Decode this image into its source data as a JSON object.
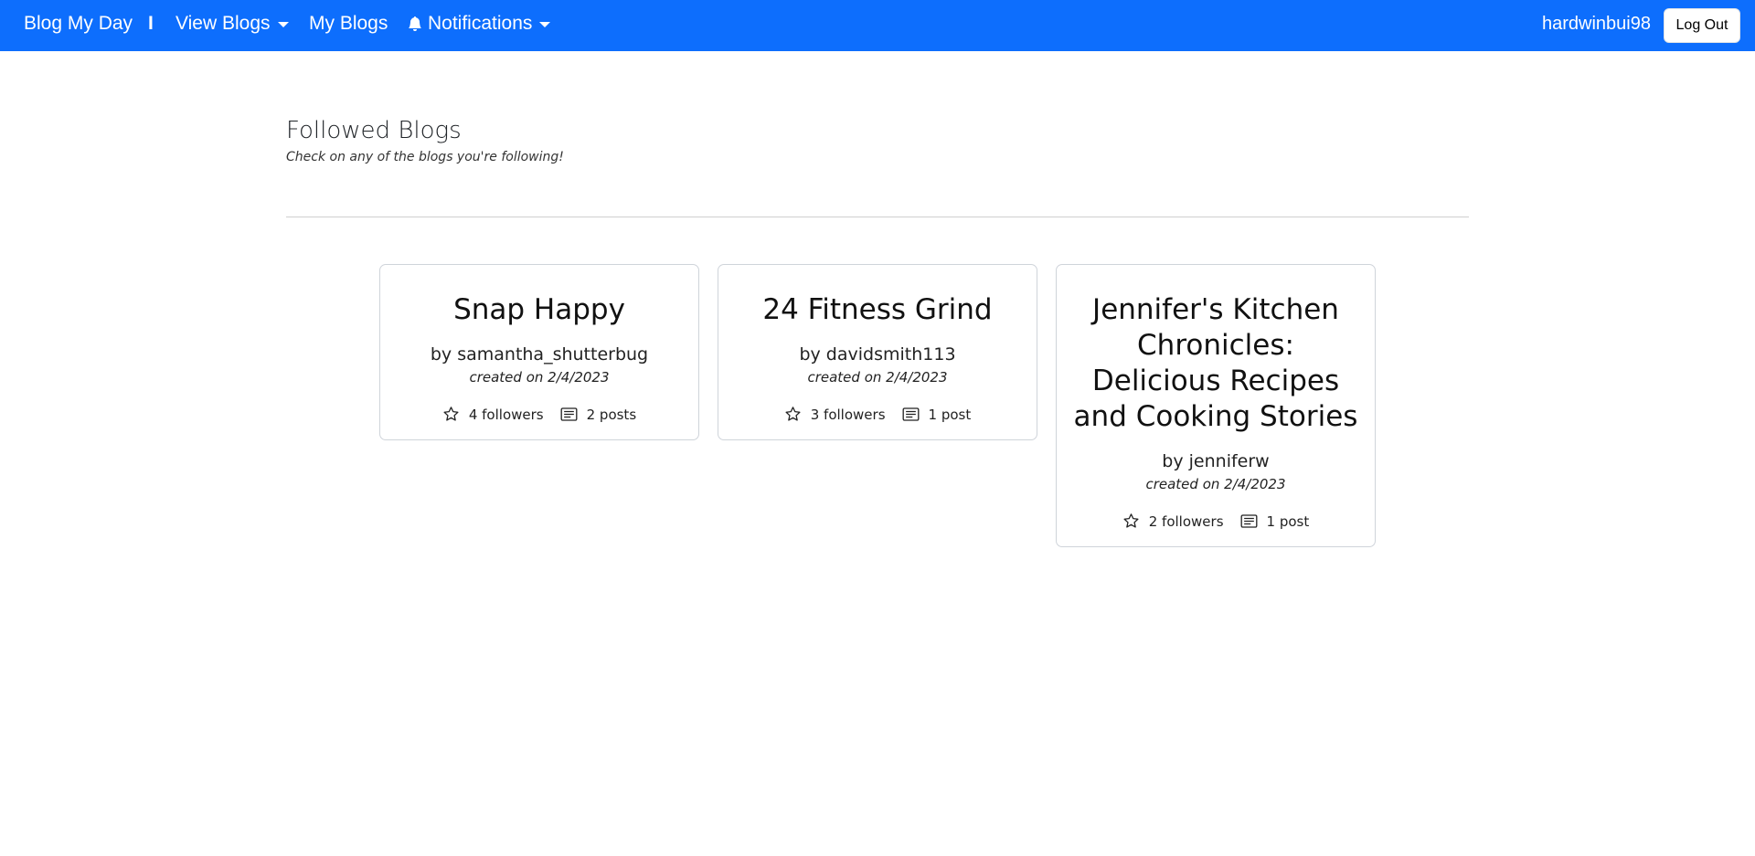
{
  "navbar": {
    "brand": "Blog My Day",
    "separator": "I",
    "view_blogs": "View Blogs",
    "my_blogs": "My Blogs",
    "notifications": "Notifications",
    "username": "hardwinbui98",
    "logout": "Log Out"
  },
  "page": {
    "title": "Followed Blogs",
    "subtitle": "Check on any of the blogs you're following!"
  },
  "blogs": [
    {
      "title": "Snap Happy",
      "author": "by samantha_shutterbug",
      "created": "created on 2/4/2023",
      "followers": "4 followers",
      "posts": "2 posts"
    },
    {
      "title": "24 Fitness Grind",
      "author": "by davidsmith113",
      "created": "created on 2/4/2023",
      "followers": "3 followers",
      "posts": "1 post"
    },
    {
      "title": "Jennifer's Kitchen Chronicles: Delicious Recipes and Cooking Stories",
      "author": "by jenniferw",
      "created": "created on 2/4/2023",
      "followers": "2 followers",
      "posts": "1 post"
    }
  ],
  "colors": {
    "navbar_bg": "#0d6efd"
  },
  "icons": {
    "follower": "star-icon",
    "post": "card-text-icon",
    "notification": "bell-icon"
  }
}
